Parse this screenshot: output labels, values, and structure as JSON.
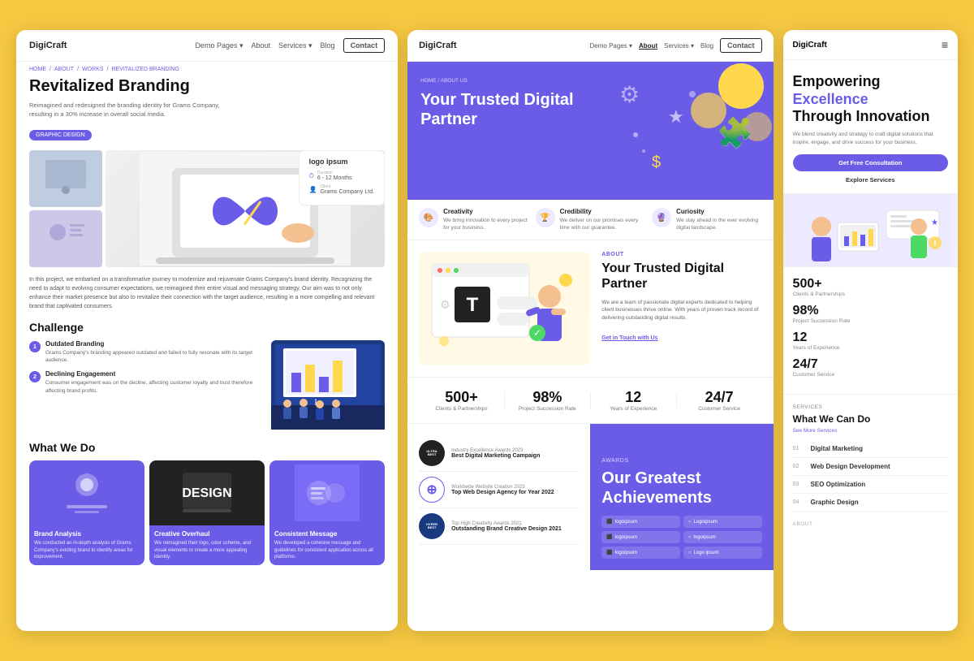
{
  "brand": "DigiCraft",
  "left_panel": {
    "nav": {
      "logo": "DigiCraft",
      "links": [
        "Demo Pages ▾",
        "About",
        "Services ▾",
        "Blog"
      ],
      "contact": "Contact"
    },
    "breadcrumb": [
      "HOME",
      "ABOUT",
      "WORKS",
      "REVITALIZED BRANDING"
    ],
    "title": "Revitalized Branding",
    "description": "Reimagined and redesigned the branding identity for Grams Company, resulting in a 30% increase in overall social media.",
    "tag": "GRAPHIC DESIGN",
    "meta": {
      "logo": "logo ipsum",
      "duration_label": "Duration",
      "duration": "6 - 12 Months",
      "client_label": "Client",
      "client": "Grams Company Ltd."
    },
    "desc_long": "In this project, we embarked on a transformative journey to modernize and rejuvenate Grams Company's brand identity. Recognizing the need to adapt to evolving consumer expectations, we reimagined their entire visual and messaging strategy. Our aim was to not only enhance their market presence but also to revitalize their connection with the target audience, resulting in a more compelling and relevant brand that captivated consumers.",
    "challenge": {
      "title": "Challenge",
      "items": [
        {
          "num": "1",
          "heading": "Outdated Branding",
          "text": "Grams Company's branding appeared outdated and failed to fully resonate with its target audience."
        },
        {
          "num": "2",
          "heading": "Declining Engagement",
          "text": "Consumer engagement was on the decline, affecting customer loyalty and trust therefore affecting brand profits."
        }
      ]
    },
    "what_we_do": {
      "title": "What We Do",
      "cards": [
        {
          "title": "Brand Analysis",
          "desc": "We conducted an in-depth analysis of Grams Company's existing brand to identify areas for improvement."
        },
        {
          "title": "Creative Overhaul",
          "desc": "We reimagined their logo, color scheme, and visual elements to create a more appealing identity."
        },
        {
          "title": "Consistent Message",
          "desc": "We developed a cohesive message and guidelines for consistent application across all platforms."
        }
      ]
    }
  },
  "middle_panel": {
    "nav": {
      "logo": "DigiCraft",
      "links": [
        "Demo Pages ▾",
        "About",
        "Services ▾",
        "Blog"
      ],
      "contact": "Contact"
    },
    "hero": {
      "breadcrumb": "HOME / ABOUT US",
      "title": "Your Trusted Digital Partner"
    },
    "features": [
      {
        "icon": "🎨",
        "title": "Creativity",
        "desc": "We bring innovation to every project for your business."
      },
      {
        "icon": "🏆",
        "title": "Credibility",
        "desc": "We deliver on our promises every time with our guarantee."
      },
      {
        "icon": "🔮",
        "title": "Curiosity",
        "desc": "We stay ahead in the ever evolving digital landscape."
      }
    ],
    "about": {
      "label": "ABOUT",
      "title": "Your Trusted Digital Partner",
      "desc": "We are a team of passionate digital experts dedicated to helping client businesses thrive online. With years of proven track record of delivering outstanding digital results.",
      "link": "Get in Touch with Us"
    },
    "stats": [
      {
        "num": "500+",
        "label": "Clients & Partnerships"
      },
      {
        "num": "98%",
        "label": "Project Succession Rate"
      },
      {
        "num": "12",
        "label": "Years of Experience"
      },
      {
        "num": "24/7",
        "label": "Customer Service"
      }
    ],
    "achievements": {
      "label": "AWARDS",
      "title": "Our Greatest Achievements",
      "awards": [
        {
          "badge": "ULTRA BEST",
          "year": "Industry Excellence Awards 2023",
          "name": "Best Digital Marketing Campaign"
        },
        {
          "badge": "⊕",
          "year": "Worldwide Website Creation 2023",
          "name": "Top Web Design Agency for Year 2022"
        },
        {
          "badge": "HYPER BEST",
          "year": "Top High Creativity Awards 2021",
          "name": "Outstanding Brand Creative Design 2021"
        }
      ],
      "logos": [
        "logoipsum",
        "Logoipsum",
        "logoipsum",
        "logoipsum",
        "logoipsum",
        "Logo ipsum"
      ]
    }
  },
  "right_panel": {
    "nav": {
      "logo": "DigiCraft"
    },
    "hero": {
      "title_line1": "Empowering",
      "title_line2": "Excellence",
      "title_line3": "Through Innovation",
      "desc": "We blend creativity and strategy to craft digital solutions that inspire, engage, and drive success for your business.",
      "cta": "Get Free Consultation",
      "explore": "Explore Services"
    },
    "stats": [
      {
        "num": "500+",
        "label": "Clients & Partnerships"
      },
      {
        "num": "98%",
        "label": "Project Succession Rate"
      },
      {
        "num": "12",
        "label": "Years of Experience"
      },
      {
        "num": "24/7",
        "label": "Customer Service"
      }
    ],
    "services": {
      "label": "SERVICES",
      "title": "What We Can Do",
      "see_more": "See More Services",
      "items": [
        {
          "num": "01",
          "name": "Digital Marketing"
        },
        {
          "num": "02",
          "name": "Web Design Development"
        },
        {
          "num": "03",
          "name": "SEO Optimization"
        },
        {
          "num": "04",
          "name": "Graphic Design"
        }
      ]
    }
  }
}
